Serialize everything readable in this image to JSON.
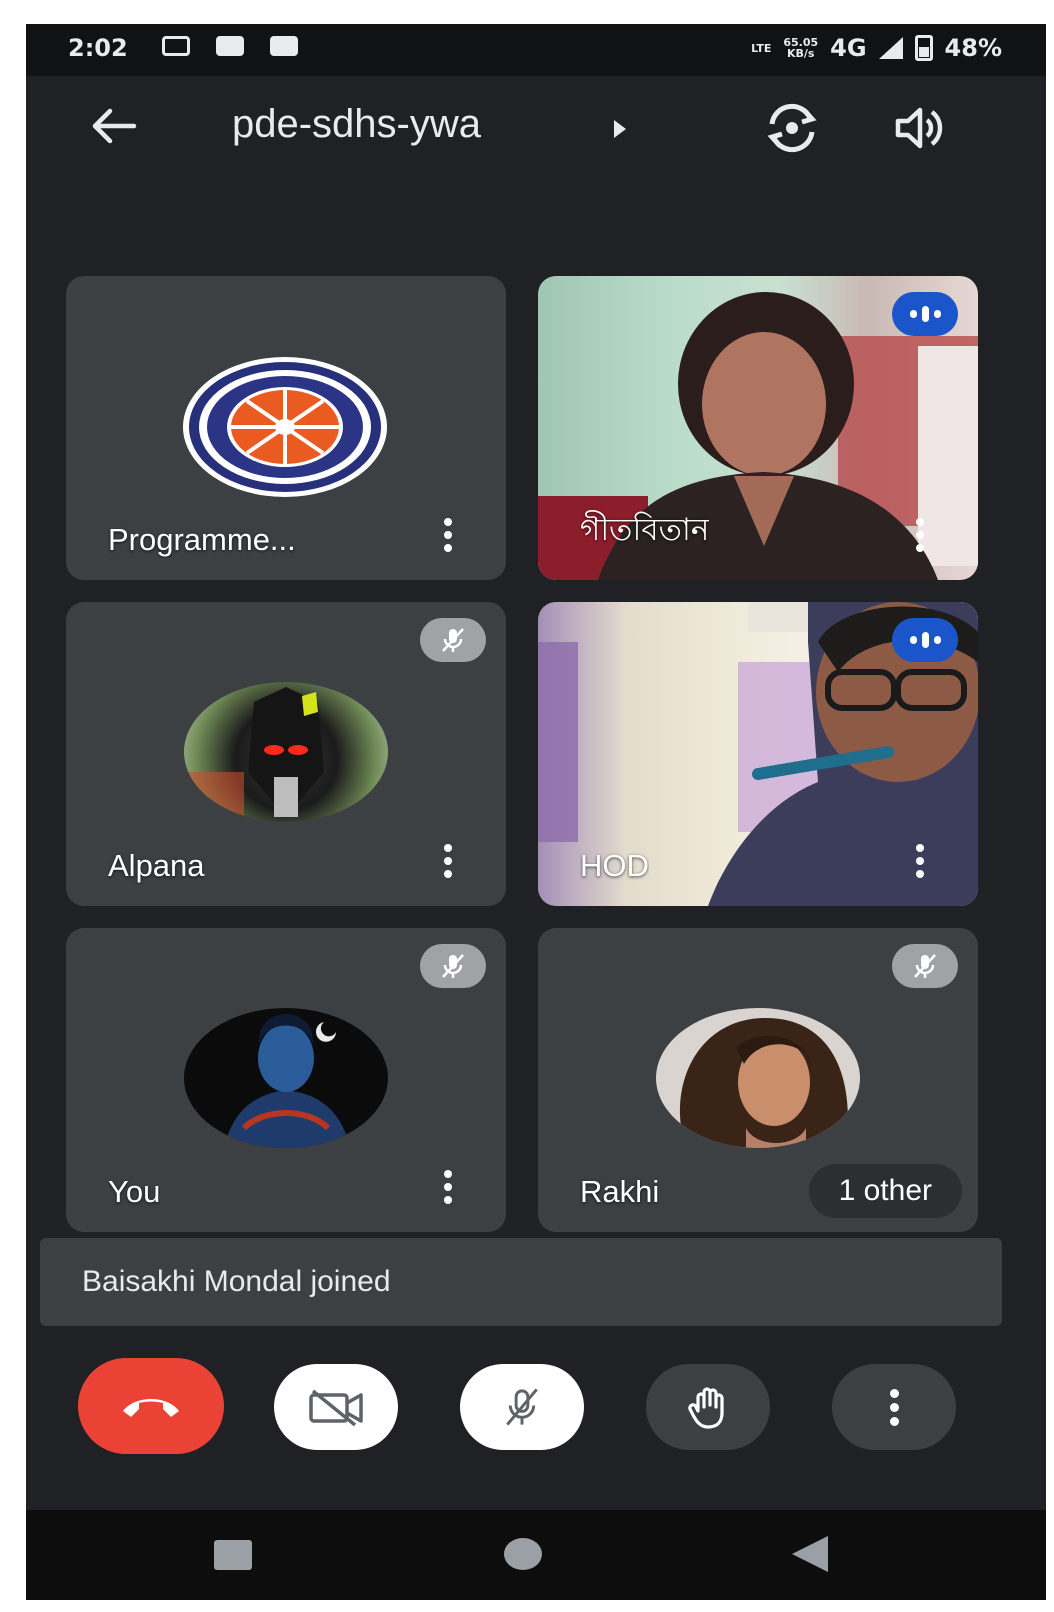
{
  "status_bar": {
    "time": "2:02",
    "network_top": "65.05",
    "network_bottom": "KB/s",
    "lte_label": "LTE",
    "network_type": "4G",
    "battery": "48%"
  },
  "header": {
    "meeting_code": "pde-sdhs-ywa",
    "icons": [
      "back-arrow-icon",
      "switch-camera-icon",
      "speaker-icon"
    ]
  },
  "participants": [
    {
      "name": "Programme...",
      "type": "avatar-logo",
      "muted": false,
      "speaking": false
    },
    {
      "name": "গীতবিতান",
      "type": "video",
      "muted": false,
      "speaking": true
    },
    {
      "name": "Alpana",
      "type": "avatar-photo",
      "muted": true,
      "speaking": false
    },
    {
      "name": "HOD",
      "type": "video",
      "muted": false,
      "speaking": true
    },
    {
      "name": "You",
      "type": "avatar-photo",
      "muted": true,
      "speaking": false
    },
    {
      "name": "Rakhi",
      "type": "avatar-photo",
      "muted": true,
      "speaking": false,
      "extra": "1 other"
    }
  ],
  "toast": {
    "message": "Baisakhi Mondal joined"
  },
  "controls": {
    "icons": [
      "end-call-icon",
      "camera-off-icon",
      "mic-off-icon",
      "raise-hand-icon",
      "more-options-icon"
    ]
  },
  "colors": {
    "background": "#202124",
    "tile": "#3c4043",
    "end_call": "#ea4335",
    "speaking_badge": "#1a56c9",
    "muted_badge": "#a0a3a6"
  }
}
